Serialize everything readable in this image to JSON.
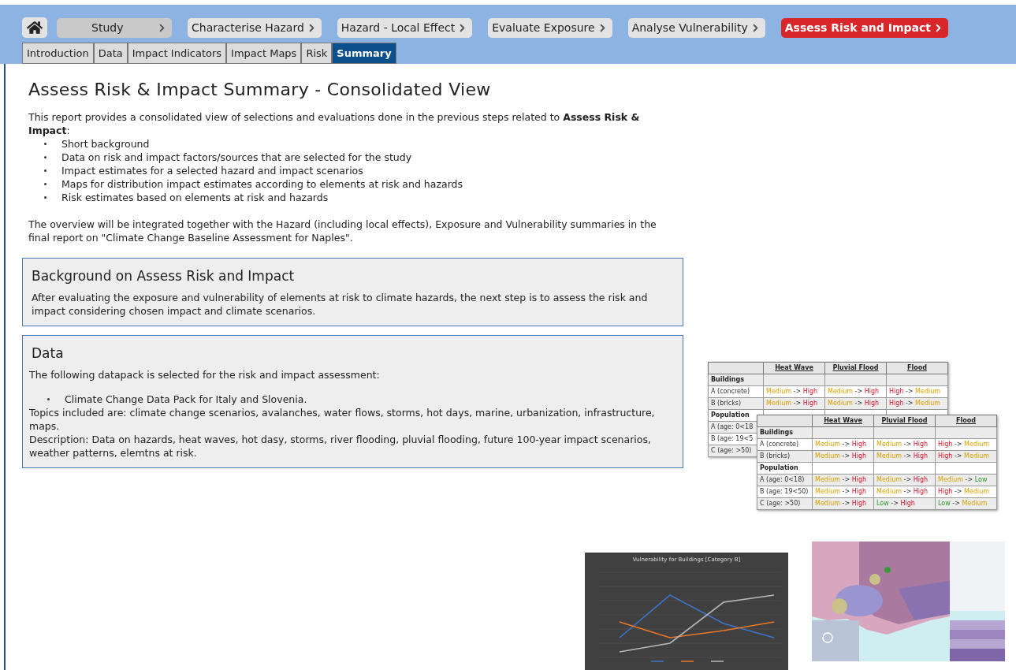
{
  "steps": [
    {
      "label": "Study",
      "kind": "muted",
      "selected": false
    },
    {
      "label": "Characterise Hazard",
      "kind": "step",
      "selected": false
    },
    {
      "label": "Hazard - Local Effect",
      "kind": "step",
      "selected": false
    },
    {
      "label": "Evaluate Exposure",
      "kind": "step",
      "selected": false
    },
    {
      "label": "Analyse Vulnerability",
      "kind": "step",
      "selected": false
    },
    {
      "label": "Assess Risk and Impact",
      "kind": "step",
      "selected": true
    }
  ],
  "tabs": [
    {
      "label": "Introduction",
      "selected": false
    },
    {
      "label": "Data",
      "selected": false
    },
    {
      "label": "Impact Indicators",
      "selected": false
    },
    {
      "label": "Impact Maps",
      "selected": false
    },
    {
      "label": "Risk",
      "selected": false
    },
    {
      "label": "Summary",
      "selected": true
    }
  ],
  "title": "Assess Risk & Impact Summary - Consolidated View",
  "intro": {
    "text": "This report provides a consolidated view of selections and evaluations done in the previous steps related to **Assess Risk & Impact**:",
    "bullets": [
      "Short background",
      "Data on risk and impact factors/sources that are selected for the study",
      "Impact estimates for a selected hazard and impact scenarios",
      "Maps for distribution impact estimates according to elements at risk and hazards",
      "Risk estimates based on elements at risk and hazards"
    ],
    "note": "The overview will be integrated together with the Hazard (including local effects), Exposure and Vulnerability summaries in the final report on \"Climate Change Baseline Assessment for Naples\"."
  },
  "sections": [
    {
      "title": "Background on Assess Risk and Impact",
      "lead": "After evaluating the exposure and vulnerability of elements at risk to climate hazards, the next step is to assess the risk and impact considering chosen impact and climate scenarios."
    },
    {
      "title": "Data",
      "lead": "The following datapack is selected for the risk and impact assessment:",
      "bullets": [
        "Climate Change Data Pack for Italy and Slovenia."
      ],
      "lines": [
        "Topics included are: climate change scenarios, avalanches, water flows, storms, hot days, marine, urbanization, infrastructure, maps.",
        "Description: Data on hazards, heat waves, hot dasy, storms, river flooding, pluvial flooding, future 100-year impact scenarios, weather patterns, elemtns at risk."
      ]
    }
  ],
  "tables": [
    {
      "columns": [
        "",
        "Heat Wave",
        "Pluvial Flood",
        "Flood"
      ],
      "rows": [
        {
          "label": "Buildings",
          "kind": "group"
        },
        {
          "label": "A (concrete)",
          "kind": "data",
          "cells": [
            [
              {
                "t": "Medium",
                "kind": "medium"
              },
              {
                "t": "->",
                "kind": "arrow"
              },
              {
                "t": "High",
                "kind": "high"
              }
            ],
            [
              {
                "t": "Medium",
                "kind": "medium"
              },
              {
                "t": "->",
                "kind": "arrow"
              },
              {
                "t": "High",
                "kind": "high"
              }
            ],
            [
              {
                "t": "High",
                "kind": "high"
              },
              {
                "t": "->",
                "kind": "arrow"
              },
              {
                "t": "Medium",
                "kind": "medium"
              }
            ]
          ]
        },
        {
          "label": "B (bricks)",
          "kind": "data",
          "cells": [
            [
              {
                "t": "Medium",
                "kind": "medium"
              },
              {
                "t": "->",
                "kind": "arrow"
              },
              {
                "t": "High",
                "kind": "high"
              }
            ],
            [
              {
                "t": "Medium",
                "kind": "medium"
              },
              {
                "t": "->",
                "kind": "arrow"
              },
              {
                "t": "High",
                "kind": "high"
              }
            ],
            [
              {
                "t": "High",
                "kind": "high"
              },
              {
                "t": "->",
                "kind": "arrow"
              },
              {
                "t": "Medium",
                "kind": "medium"
              }
            ]
          ]
        },
        {
          "label": "Population",
          "kind": "group"
        },
        {
          "label": "A (age: 0<18",
          "kind": "data",
          "cells": []
        },
        {
          "label": "B (age: 19<5",
          "kind": "data",
          "cells": []
        },
        {
          "label": "C (age: >50)",
          "kind": "data",
          "cells": []
        }
      ]
    },
    {
      "columns": [
        "",
        "Heat Wave",
        "Pluvial Flood",
        "Flood"
      ],
      "rows": [
        {
          "label": "Buildings",
          "kind": "group"
        },
        {
          "label": "A (concrete)",
          "kind": "data",
          "cells": [
            [
              {
                "t": "Medium",
                "kind": "medium"
              },
              {
                "t": "->",
                "kind": "arrow"
              },
              {
                "t": "High",
                "kind": "high"
              }
            ],
            [
              {
                "t": "Medium",
                "kind": "medium"
              },
              {
                "t": "->",
                "kind": "arrow"
              },
              {
                "t": "High",
                "kind": "high"
              }
            ],
            [
              {
                "t": "High",
                "kind": "high"
              },
              {
                "t": "->",
                "kind": "arrow"
              },
              {
                "t": "Medium",
                "kind": "medium"
              }
            ]
          ]
        },
        {
          "label": "B (bricks)",
          "kind": "data",
          "cells": [
            [
              {
                "t": "Medium",
                "kind": "medium"
              },
              {
                "t": "->",
                "kind": "arrow"
              },
              {
                "t": "High",
                "kind": "high"
              }
            ],
            [
              {
                "t": "Medium",
                "kind": "medium"
              },
              {
                "t": "->",
                "kind": "arrow"
              },
              {
                "t": "High",
                "kind": "high"
              }
            ],
            [
              {
                "t": "High",
                "kind": "high"
              },
              {
                "t": "->",
                "kind": "arrow"
              },
              {
                "t": "Medium",
                "kind": "medium"
              }
            ]
          ]
        },
        {
          "label": "Population",
          "kind": "group"
        },
        {
          "label": "A (age: 0<18)",
          "kind": "data",
          "cells": [
            [
              {
                "t": "Medium",
                "kind": "medium"
              },
              {
                "t": "->",
                "kind": "arrow"
              },
              {
                "t": "High",
                "kind": "high"
              }
            ],
            [
              {
                "t": "Medium",
                "kind": "medium"
              },
              {
                "t": "->",
                "kind": "arrow"
              },
              {
                "t": "High",
                "kind": "high"
              }
            ],
            [
              {
                "t": "Medium",
                "kind": "medium"
              },
              {
                "t": "->",
                "kind": "arrow"
              },
              {
                "t": "Low",
                "kind": "low"
              }
            ]
          ]
        },
        {
          "label": "B (age: 19<50)",
          "kind": "data",
          "cells": [
            [
              {
                "t": "Medium",
                "kind": "medium"
              },
              {
                "t": "->",
                "kind": "arrow"
              },
              {
                "t": "High",
                "kind": "high"
              }
            ],
            [
              {
                "t": "Medium",
                "kind": "medium"
              },
              {
                "t": "->",
                "kind": "arrow"
              },
              {
                "t": "High",
                "kind": "high"
              }
            ],
            [
              {
                "t": "High",
                "kind": "high"
              },
              {
                "t": "->",
                "kind": "arrow"
              },
              {
                "t": "Medium",
                "kind": "medium"
              }
            ]
          ]
        },
        {
          "label": "C (age: >50)",
          "kind": "data",
          "cells": [
            [
              {
                "t": "Medium",
                "kind": "medium"
              },
              {
                "t": "->",
                "kind": "arrow"
              },
              {
                "t": "High",
                "kind": "high"
              }
            ],
            [
              {
                "t": "Low",
                "kind": "low"
              },
              {
                "t": "->",
                "kind": "arrow"
              },
              {
                "t": "High",
                "kind": "high"
              }
            ],
            [
              {
                "t": "Low",
                "kind": "low"
              },
              {
                "t": "->",
                "kind": "arrow"
              },
              {
                "t": "Medium",
                "kind": "medium"
              }
            ]
          ]
        }
      ]
    }
  ],
  "chart": {
    "title": "Vulnerability for Buildings [Category B]"
  }
}
